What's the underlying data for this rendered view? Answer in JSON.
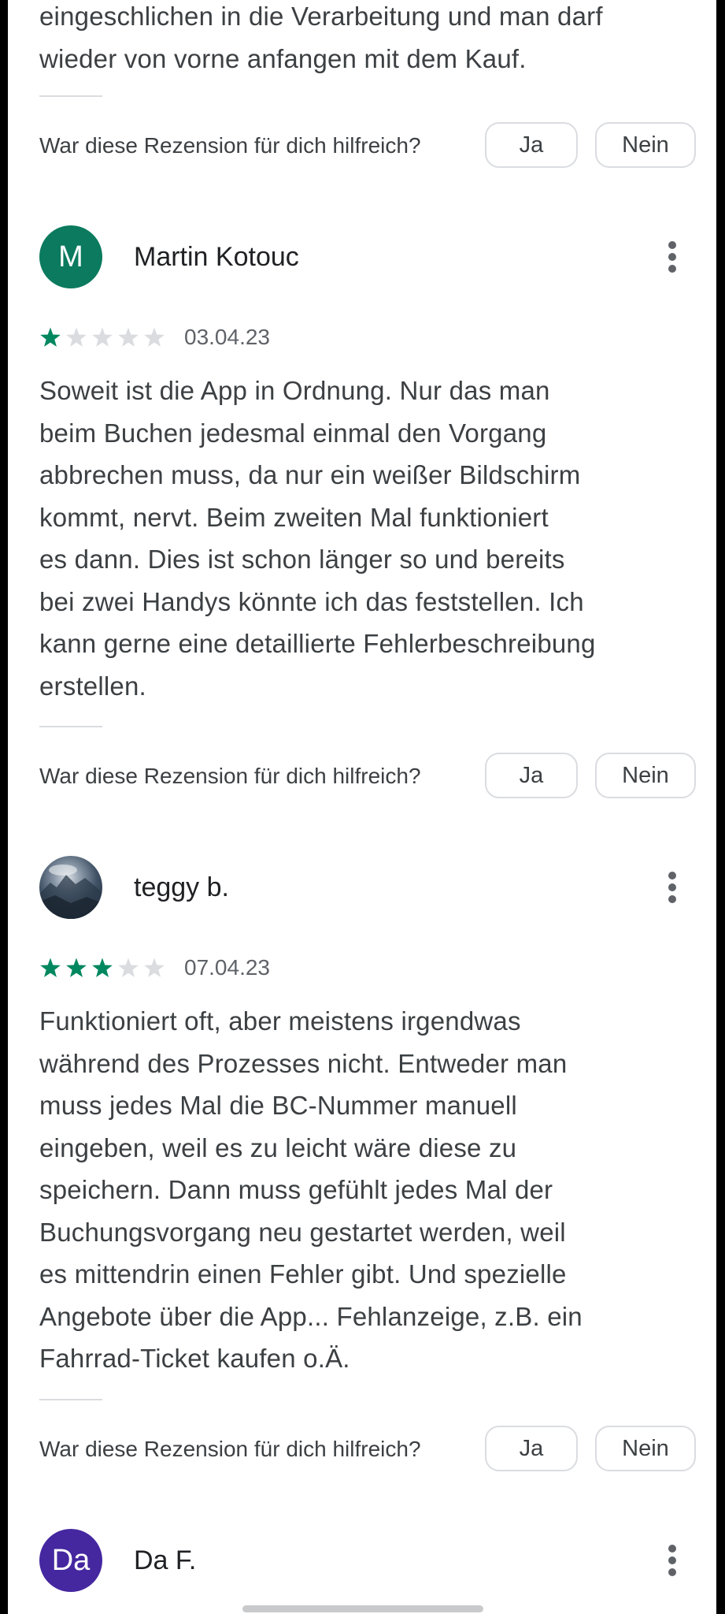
{
  "top_review": {
    "lines": [
      "eingeschlichen in die Verarbeitung und man darf",
      "wieder von vorne anfangen mit dem Kauf."
    ]
  },
  "helpful": {
    "question": "War diese Rezension für dich hilfreich?",
    "yes": "Ja",
    "no": "Nein"
  },
  "reviews": [
    {
      "author": "Martin Kotouc",
      "avatar_letter": "M",
      "avatar_color": "#188038",
      "rating": 1,
      "date": "03.04.23",
      "lines": [
        "Soweit ist die App in Ordnung. Nur das man",
        "beim Buchen jedesmal einmal den Vorgang",
        "abbrechen muss, da nur ein weißer Bildschirm",
        "kommt, nervt. Beim zweiten Mal funktioniert",
        "es dann. Dies ist schon länger so und bereits",
        "bei zwei Handys könnte ich das feststellen. Ich",
        "kann gerne eine detaillierte Fehlerbeschreibung",
        "erstellen."
      ]
    },
    {
      "author": "teggy b.",
      "avatar_letter": "",
      "avatar_color": "#3a4a5c",
      "rating": 3,
      "date": "07.04.23",
      "lines": [
        "Funktioniert oft, aber meistens irgendwas",
        "während des Prozesses nicht. Entweder man",
        "muss jedes Mal die BC-Nummer manuell",
        "eingeben, weil es zu leicht wäre diese zu",
        "speichern. Dann muss gefühlt jedes Mal der",
        "Buchungsvorgang neu gestartet werden, weil",
        "es mittendrin einen Fehler gibt. Und spezielle",
        "Angebote über die App... Fehlanzeige, z.B. ein",
        "Fahrrad-Ticket kaufen o.Ä."
      ]
    },
    {
      "author": "Da F.",
      "avatar_letter": "Da",
      "avatar_color": "#4527a0"
    }
  ],
  "colors": {
    "star_filled": "#01875f",
    "star_empty": "#dadce0",
    "text": "#3c4043"
  },
  "icons": [
    "more-vert-icon",
    "star-icon"
  ]
}
